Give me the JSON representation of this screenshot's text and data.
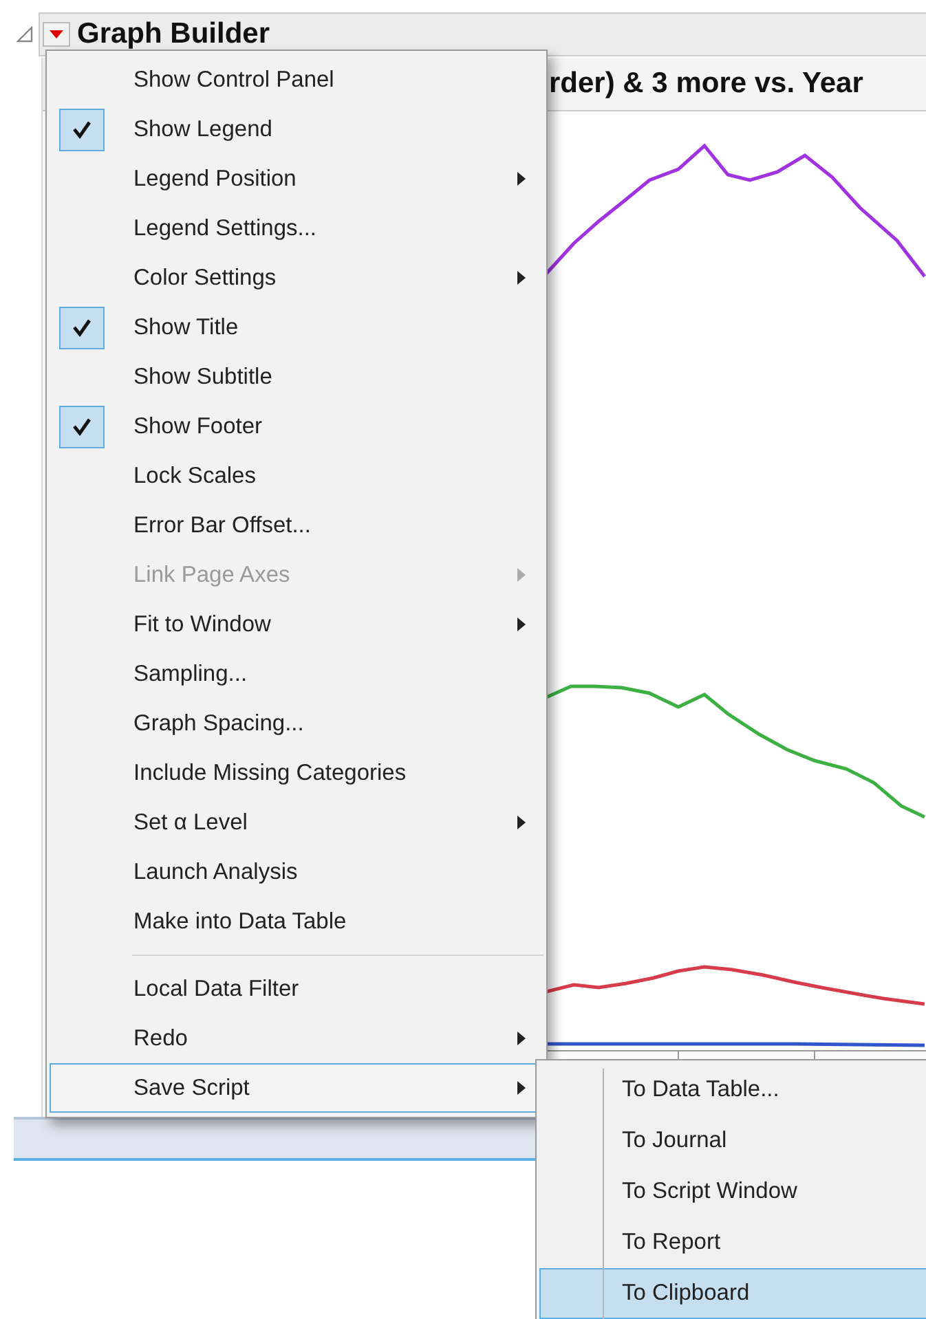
{
  "panel": {
    "title": "Graph Builder",
    "graph_title": "rder) & 3 more vs. Year"
  },
  "menu": [
    {
      "kind": "item",
      "label": "Show Control Panel",
      "checked": false,
      "submenu": false,
      "disabled": false,
      "selected": false
    },
    {
      "kind": "item",
      "label": "Show Legend",
      "checked": true,
      "submenu": false,
      "disabled": false,
      "selected": false
    },
    {
      "kind": "item",
      "label": "Legend Position",
      "checked": false,
      "submenu": true,
      "disabled": false,
      "selected": false
    },
    {
      "kind": "item",
      "label": "Legend Settings...",
      "checked": false,
      "submenu": false,
      "disabled": false,
      "selected": false
    },
    {
      "kind": "item",
      "label": "Color Settings",
      "checked": false,
      "submenu": true,
      "disabled": false,
      "selected": false
    },
    {
      "kind": "item",
      "label": "Show Title",
      "checked": true,
      "submenu": false,
      "disabled": false,
      "selected": false
    },
    {
      "kind": "item",
      "label": "Show Subtitle",
      "checked": false,
      "submenu": false,
      "disabled": false,
      "selected": false
    },
    {
      "kind": "item",
      "label": "Show Footer",
      "checked": true,
      "submenu": false,
      "disabled": false,
      "selected": false
    },
    {
      "kind": "item",
      "label": "Lock Scales",
      "checked": false,
      "submenu": false,
      "disabled": false,
      "selected": false
    },
    {
      "kind": "item",
      "label": "Error Bar Offset...",
      "checked": false,
      "submenu": false,
      "disabled": false,
      "selected": false
    },
    {
      "kind": "item",
      "label": "Link Page Axes",
      "checked": false,
      "submenu": true,
      "disabled": true,
      "selected": false
    },
    {
      "kind": "item",
      "label": "Fit to Window",
      "checked": false,
      "submenu": true,
      "disabled": false,
      "selected": false
    },
    {
      "kind": "item",
      "label": "Sampling...",
      "checked": false,
      "submenu": false,
      "disabled": false,
      "selected": false
    },
    {
      "kind": "item",
      "label": "Graph Spacing...",
      "checked": false,
      "submenu": false,
      "disabled": false,
      "selected": false
    },
    {
      "kind": "item",
      "label": "Include Missing Categories",
      "checked": false,
      "submenu": false,
      "disabled": false,
      "selected": false
    },
    {
      "kind": "item",
      "label": "Set α Level",
      "checked": false,
      "submenu": true,
      "disabled": false,
      "selected": false
    },
    {
      "kind": "item",
      "label": "Launch Analysis",
      "checked": false,
      "submenu": false,
      "disabled": false,
      "selected": false
    },
    {
      "kind": "item",
      "label": "Make into Data Table",
      "checked": false,
      "submenu": false,
      "disabled": false,
      "selected": false
    },
    {
      "kind": "separator"
    },
    {
      "kind": "item",
      "label": "Local Data Filter",
      "checked": false,
      "submenu": false,
      "disabled": false,
      "selected": false
    },
    {
      "kind": "item",
      "label": "Redo",
      "checked": false,
      "submenu": true,
      "disabled": false,
      "selected": false
    },
    {
      "kind": "item",
      "label": "Save Script",
      "checked": false,
      "submenu": true,
      "disabled": false,
      "selected": true
    }
  ],
  "submenu": [
    {
      "label": "To Data Table...",
      "selected": false
    },
    {
      "label": "To Journal",
      "selected": false
    },
    {
      "label": "To Script Window",
      "selected": false
    },
    {
      "label": "To Report",
      "selected": false
    },
    {
      "label": "To Clipboard",
      "selected": true
    }
  ]
}
